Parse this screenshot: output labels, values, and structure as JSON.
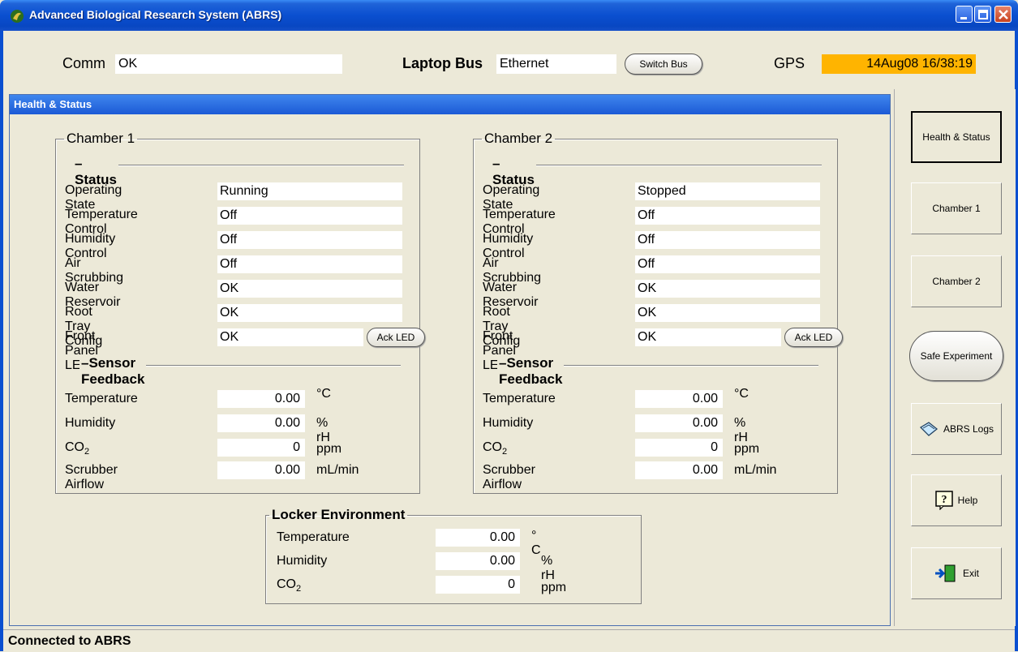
{
  "window": {
    "title": "Advanced Biological Research System (ABRS)"
  },
  "header": {
    "comm_label": "Comm",
    "comm_value": "OK",
    "bus_label": "Laptop Bus",
    "bus_value": "Ethernet",
    "switch_bus_label": "Switch Bus",
    "gps_label": "GPS",
    "gps_value": "14Aug08 16/38:19",
    "gps_color": "#ffb400"
  },
  "panel": {
    "title": "Health & Status"
  },
  "chambers": [
    {
      "title": "Chamber 1",
      "status_heading": "Status",
      "status": [
        {
          "label": "Operating State",
          "value": "Running"
        },
        {
          "label": "Temperature Control",
          "value": "Off"
        },
        {
          "label": "Humidity Control",
          "value": "Off"
        },
        {
          "label": "Air Scrubbing",
          "value": "Off"
        },
        {
          "label": "Water Reservoir",
          "value": "OK"
        },
        {
          "label": "Root Tray Config",
          "value": "OK"
        },
        {
          "label": "Front Panel LED",
          "value": "OK"
        }
      ],
      "ack_led_label": "Ack LED",
      "sensor_heading": "Sensor Feedback",
      "sensors": [
        {
          "label": "Temperature",
          "value": "0.00",
          "unit": "°C"
        },
        {
          "label": "Humidity",
          "value": "0.00",
          "unit": "% rH"
        },
        {
          "label": "CO",
          "label_sub": "2",
          "value": "0",
          "unit": "ppm"
        },
        {
          "label": "Scrubber Airflow",
          "value": "0.00",
          "unit": "mL/min"
        }
      ]
    },
    {
      "title": "Chamber 2",
      "status_heading": "Status",
      "status": [
        {
          "label": "Operating State",
          "value": "Stopped"
        },
        {
          "label": "Temperature Control",
          "value": "Off"
        },
        {
          "label": "Humidity Control",
          "value": "Off"
        },
        {
          "label": "Air Scrubbing",
          "value": "Off"
        },
        {
          "label": "Water Reservoir",
          "value": "OK"
        },
        {
          "label": "Root Tray Config",
          "value": "OK"
        },
        {
          "label": "Front Panel LED",
          "value": "OK"
        }
      ],
      "ack_led_label": "Ack LED",
      "sensor_heading": "Sensor Feedback",
      "sensors": [
        {
          "label": "Temperature",
          "value": "0.00",
          "unit": "°C"
        },
        {
          "label": "Humidity",
          "value": "0.00",
          "unit": "% rH"
        },
        {
          "label": "CO",
          "label_sub": "2",
          "value": "0",
          "unit": "ppm"
        },
        {
          "label": "Scrubber Airflow",
          "value": "0.00",
          "unit": "mL/min"
        }
      ]
    }
  ],
  "locker": {
    "title": "Locker Environment",
    "rows": [
      {
        "label": "Temperature",
        "value": "0.00",
        "unit": "° C"
      },
      {
        "label": "Humidity",
        "value": "0.00",
        "unit": "% rH"
      },
      {
        "label": "CO",
        "label_sub": "2",
        "value": "0",
        "unit": "ppm"
      }
    ]
  },
  "nav": {
    "health_status": "Health & Status",
    "chamber1": "Chamber 1",
    "chamber2": "Chamber 2",
    "safe_experiment": "Safe Experiment",
    "abrs_logs": "ABRS Logs",
    "help": "Help",
    "exit": "Exit"
  },
  "statusbar": {
    "text": "Connected to ABRS"
  }
}
